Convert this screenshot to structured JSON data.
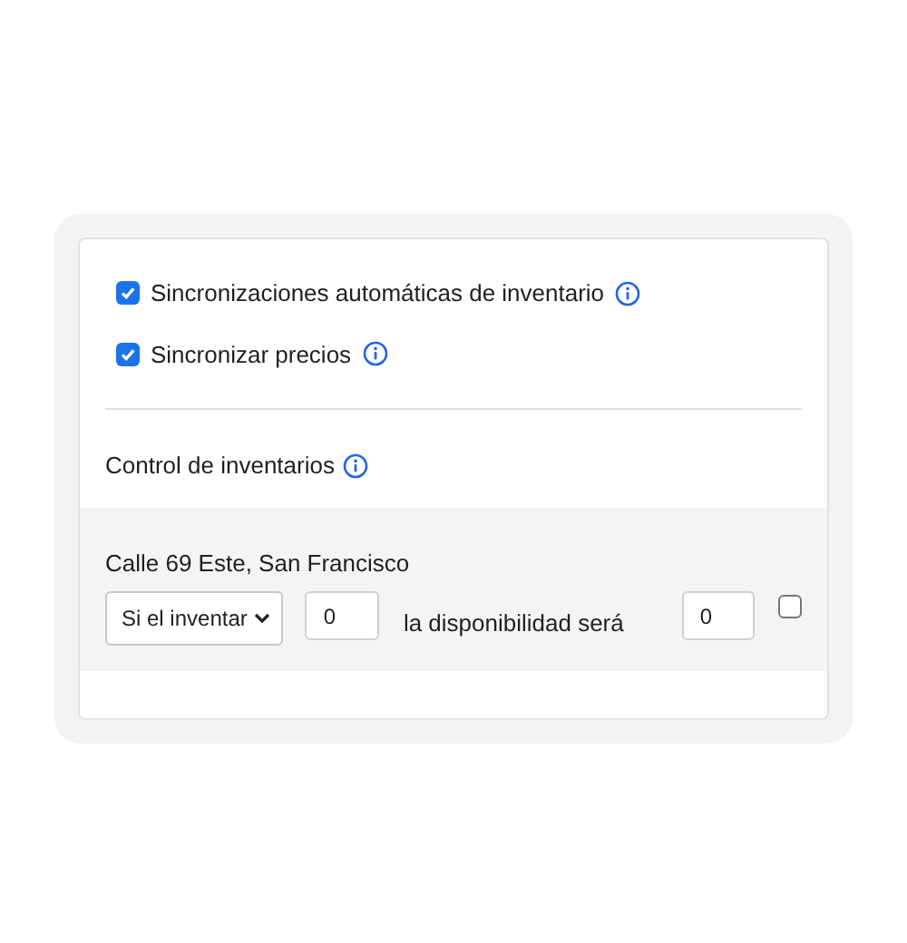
{
  "sync_options": [
    {
      "label": "Sincronizaciones automáticas de inventario",
      "checked": true
    },
    {
      "label": "Sincronizar precios",
      "checked": true
    }
  ],
  "inventory_control": {
    "title": "Control de inventarios",
    "locations": [
      {
        "name": "Calle 69 Este, San Francisco",
        "condition": "Si el inventar",
        "threshold": "0",
        "result_label": "la disponibilidad será",
        "availability": "0",
        "checked": false
      }
    ]
  }
}
